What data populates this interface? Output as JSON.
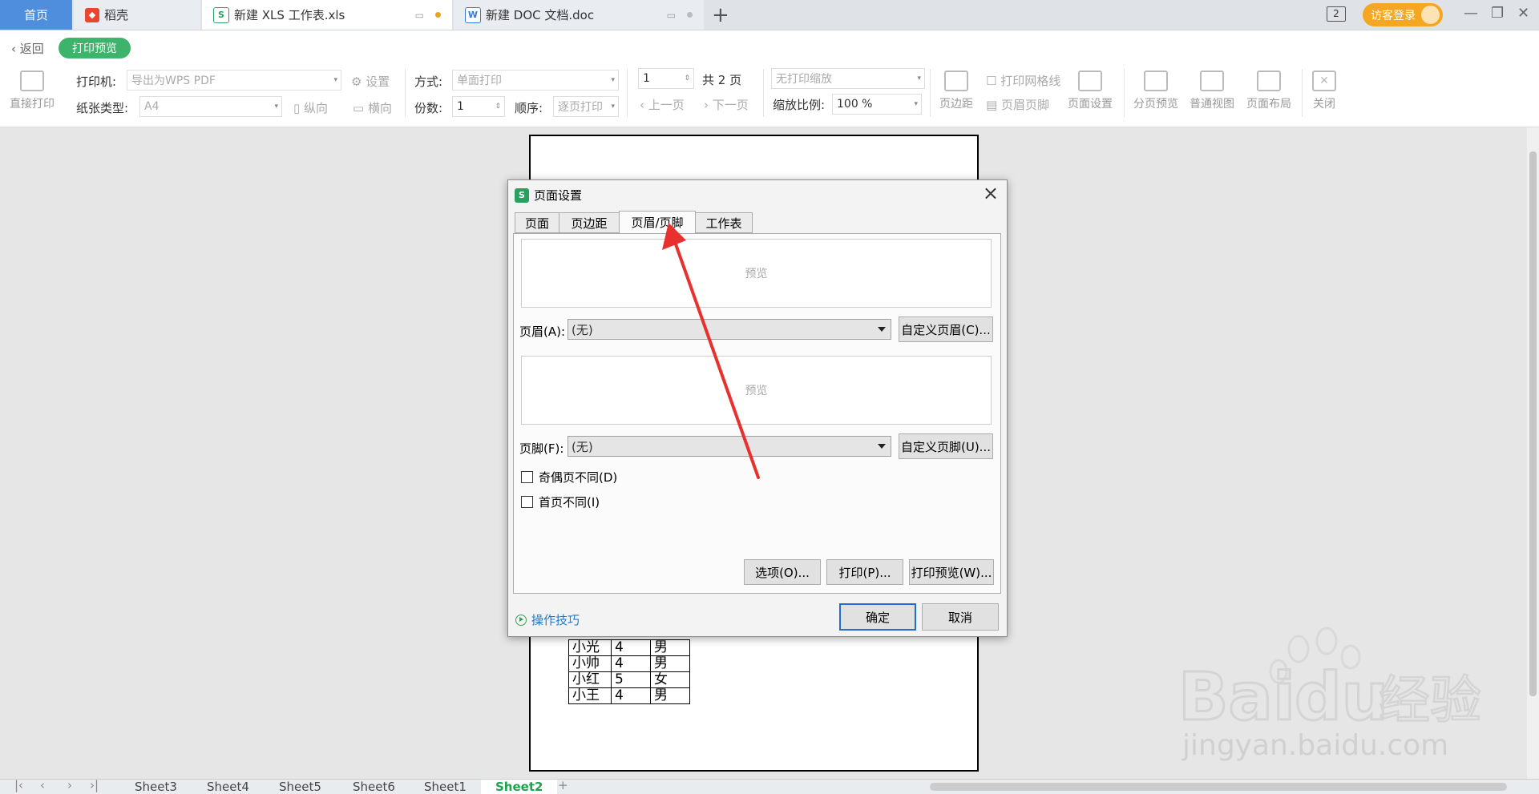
{
  "tabs": {
    "home": "首页",
    "shell": "稻壳",
    "xls": "新建 XLS 工作表.xls",
    "doc": "新建 DOC 文档.doc"
  },
  "top_right": {
    "badge": "2",
    "login": "访客登录"
  },
  "toolbar": {
    "back": "返回",
    "print_preview": "打印预览",
    "direct_print": "直接打印",
    "printer_label": "打印机:",
    "printer_value": "导出为WPS PDF",
    "settings": "设置",
    "paper_label": "纸张类型:",
    "paper_value": "A4",
    "portrait": "纵向",
    "landscape": "横向",
    "mode_label": "方式:",
    "mode_value": "单面打印",
    "copies_label": "份数:",
    "copies_value": "1",
    "order_label": "顺序:",
    "order_value": "逐页打印",
    "page_value": "1",
    "total_pages": "共 2 页",
    "prev_page": "上一页",
    "next_page": "下一页",
    "scale_mode": "无打印缩放",
    "scale_label": "缩放比例:",
    "scale_value": "100 %",
    "print_grid": "打印网格线",
    "margins": "页边距",
    "header_footer": "页眉页脚",
    "page_setup": "页面设置",
    "page_break": "分页预览",
    "normal_view": "普通视图",
    "page_layout": "页面布局",
    "close": "关闭"
  },
  "table_rows": [
    [
      "小光",
      "4",
      "男"
    ],
    [
      "小帅",
      "4",
      "男"
    ],
    [
      "小红",
      "5",
      "女"
    ],
    [
      "小王",
      "4",
      "男"
    ]
  ],
  "sheets": [
    "Sheet3",
    "Sheet4",
    "Sheet5",
    "Sheet6",
    "Sheet1",
    "Sheet2"
  ],
  "dialog": {
    "title": "页面设置",
    "tabs": [
      "页面",
      "页边距",
      "页眉/页脚",
      "工作表"
    ],
    "preview": "预览",
    "header_label": "页眉(A):",
    "header_value": "(无)",
    "custom_header": "自定义页眉(C)...",
    "footer_label": "页脚(F):",
    "footer_value": "(无)",
    "custom_footer": "自定义页脚(U)...",
    "odd_even": "奇偶页不同(D)",
    "first_page": "首页不同(I)",
    "options": "选项(O)...",
    "print": "打印(P)...",
    "print_preview": "打印预览(W)...",
    "tips": "操作技巧",
    "ok": "确定",
    "cancel": "取消"
  },
  "watermark": {
    "brand": "Bai",
    "brand2": "du",
    "cn": "经验",
    "url": "jingyan.baidu.com"
  },
  "colors": {
    "accent_green": "#3db36b",
    "tab_blue": "#4f8edc",
    "arrow_red": "#e8312f",
    "link_blue": "#1e7bd0"
  }
}
